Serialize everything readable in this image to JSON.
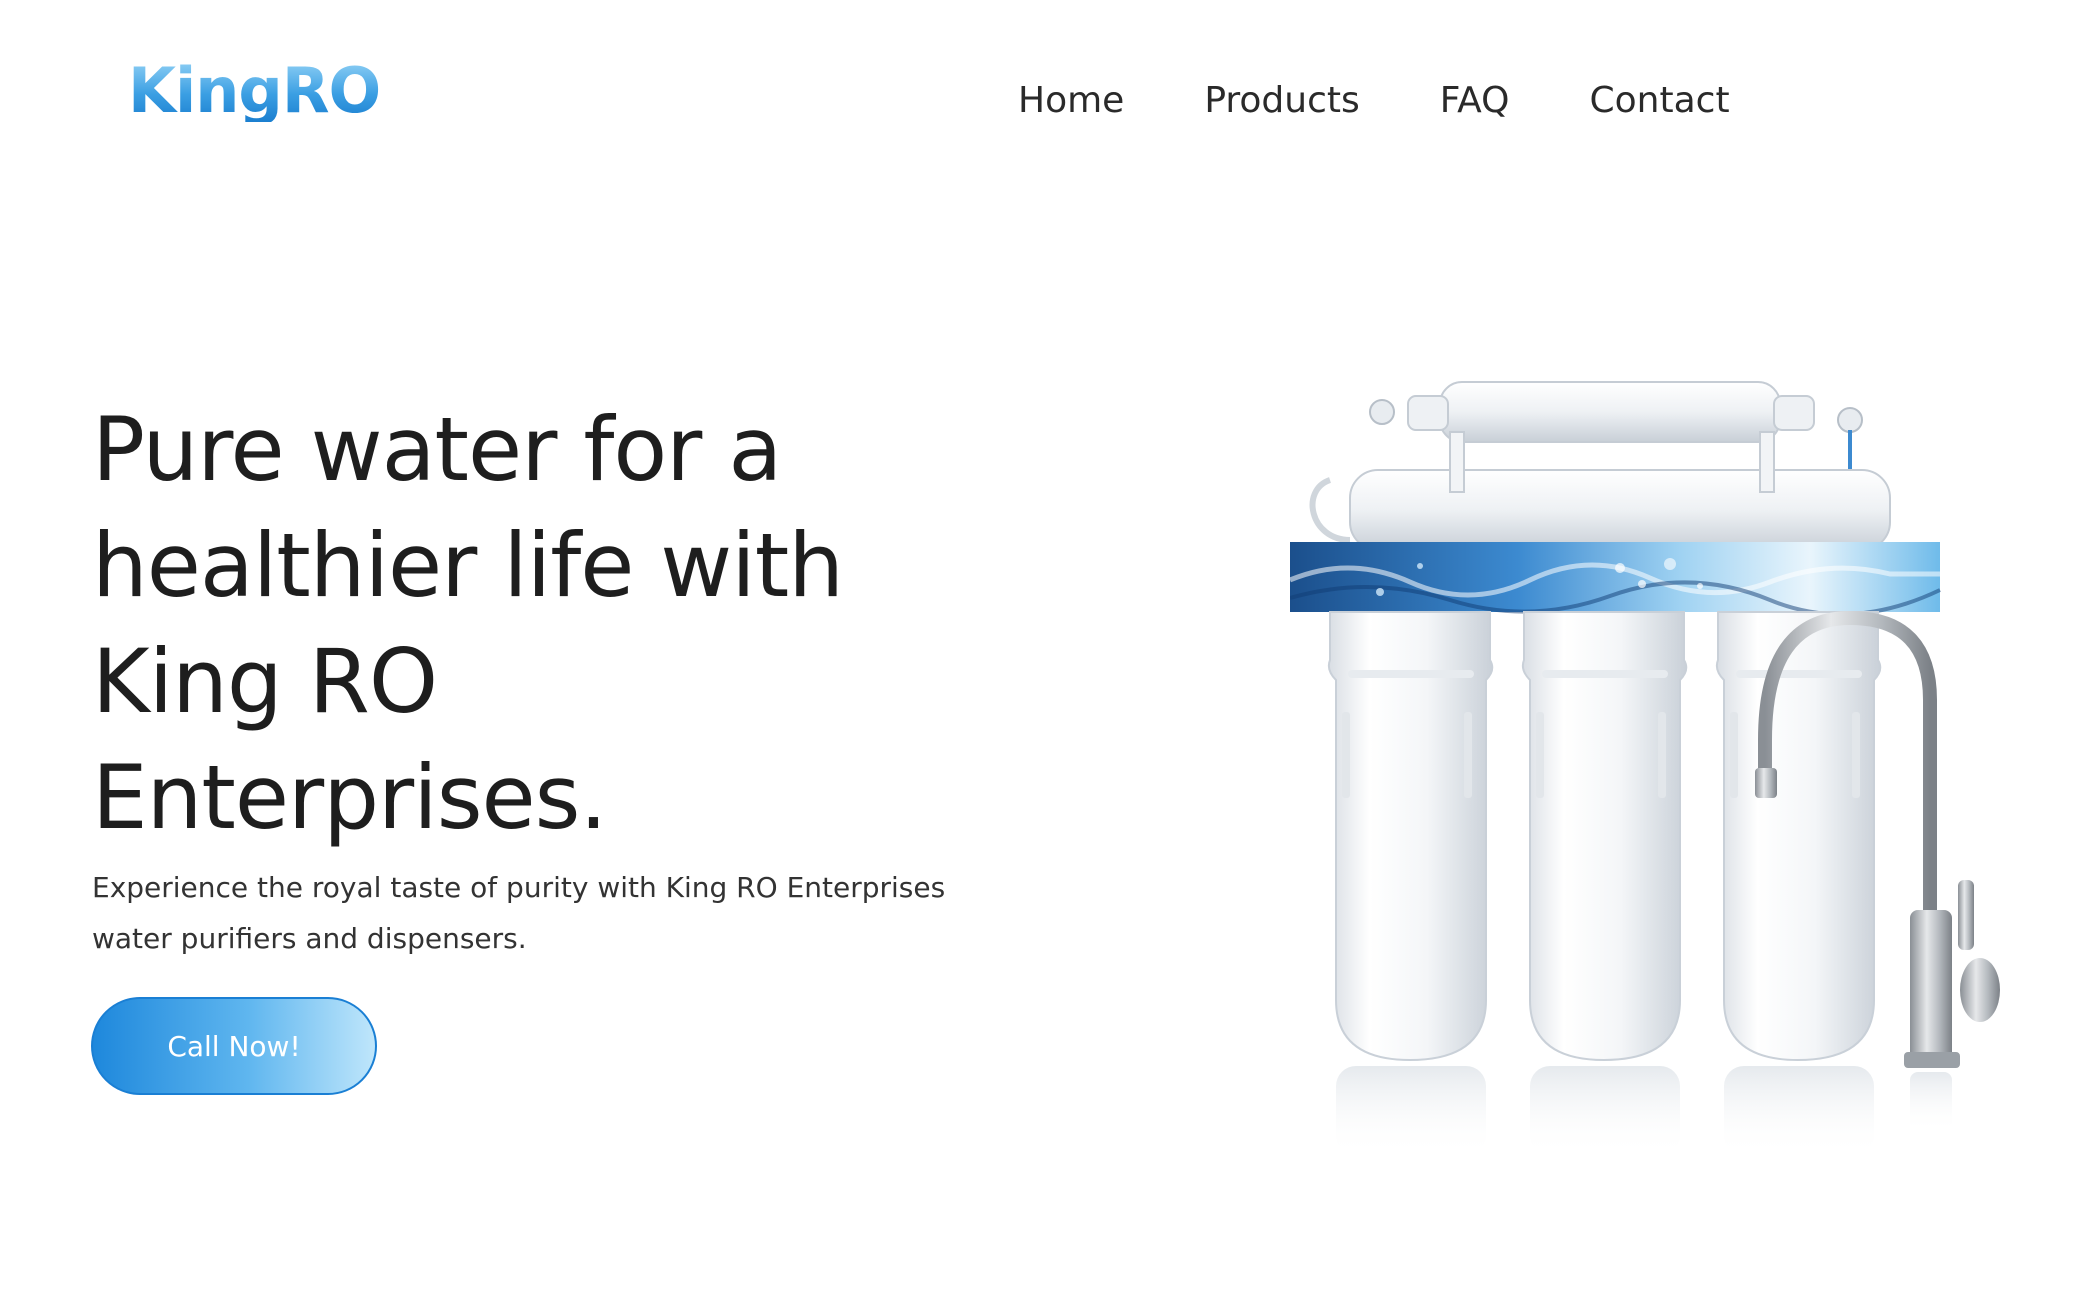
{
  "header": {
    "logo_text": "KingRO",
    "nav": [
      {
        "label": "Home"
      },
      {
        "label": "Products"
      },
      {
        "label": "FAQ"
      },
      {
        "label": "Contact"
      }
    ]
  },
  "hero": {
    "title_lines": [
      "Pure water for a",
      "healthier life with",
      "King RO",
      "Enterprises."
    ],
    "subtitle_lines": [
      "Experience the royal taste of purity with King RO Enterprises",
      "water purifiers and dispensers."
    ],
    "cta_label": "Call Now!"
  },
  "product_image": {
    "subject": "ro-water-purifier-with-faucet-icon"
  },
  "colors": {
    "background": "#ffffff",
    "text": "#1e1e1e",
    "accent": "#1e88dc",
    "accent_light": "#bfe6fb",
    "logo_blue": "#3b9fe3"
  }
}
